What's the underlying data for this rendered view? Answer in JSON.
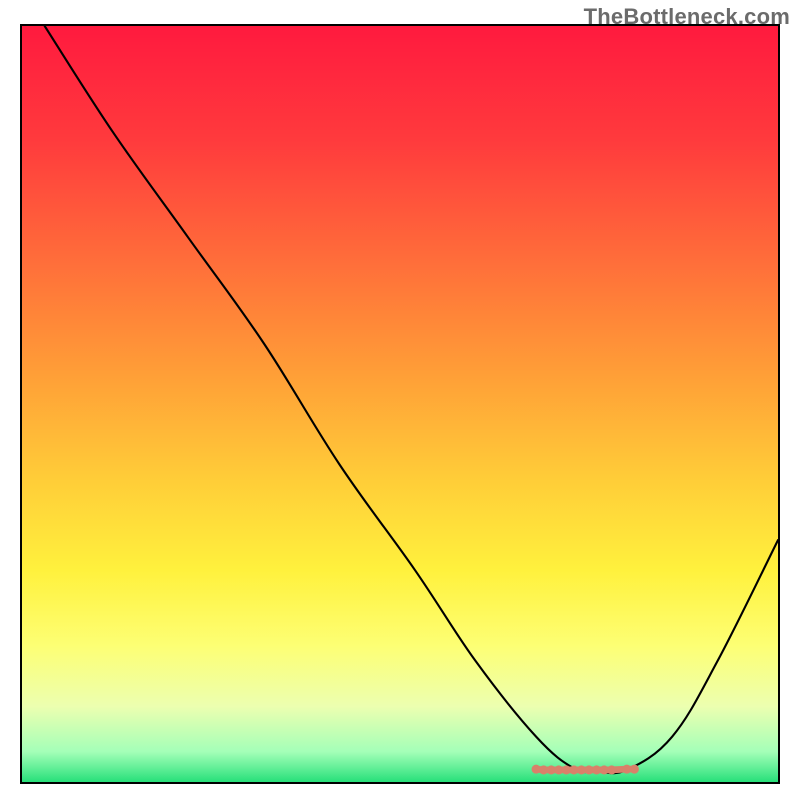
{
  "watermark": "TheBottleneck.com",
  "chart_data": {
    "type": "line",
    "title": "",
    "xlabel": "",
    "ylabel": "",
    "xlim": [
      0,
      100
    ],
    "ylim": [
      0,
      100
    ],
    "series": [
      {
        "name": "bottleneck-curve",
        "x": [
          3,
          12,
          22,
          32,
          42,
          52,
          60,
          68,
          73,
          76,
          80,
          86,
          92,
          100
        ],
        "y": [
          100,
          86,
          72,
          58,
          42,
          28,
          16,
          6,
          1.8,
          1.4,
          1.6,
          6,
          16,
          32
        ]
      }
    ],
    "markers": {
      "name": "selected-range",
      "color": "#d9816a",
      "x": [
        68,
        69,
        70,
        71,
        72,
        73,
        74,
        75,
        76,
        77,
        78,
        80,
        81
      ],
      "y": [
        1.7,
        1.6,
        1.6,
        1.6,
        1.6,
        1.6,
        1.6,
        1.6,
        1.6,
        1.6,
        1.6,
        1.7,
        1.7
      ]
    },
    "gradient_stops": [
      {
        "offset": 0,
        "color": "#ff1a3e"
      },
      {
        "offset": 15,
        "color": "#ff3a3d"
      },
      {
        "offset": 30,
        "color": "#ff6a3a"
      },
      {
        "offset": 45,
        "color": "#ff9b37"
      },
      {
        "offset": 60,
        "color": "#ffcd38"
      },
      {
        "offset": 72,
        "color": "#fff13d"
      },
      {
        "offset": 82,
        "color": "#fdff74"
      },
      {
        "offset": 90,
        "color": "#ecffb0"
      },
      {
        "offset": 96,
        "color": "#a4ffb8"
      },
      {
        "offset": 100,
        "color": "#28e07a"
      }
    ]
  }
}
